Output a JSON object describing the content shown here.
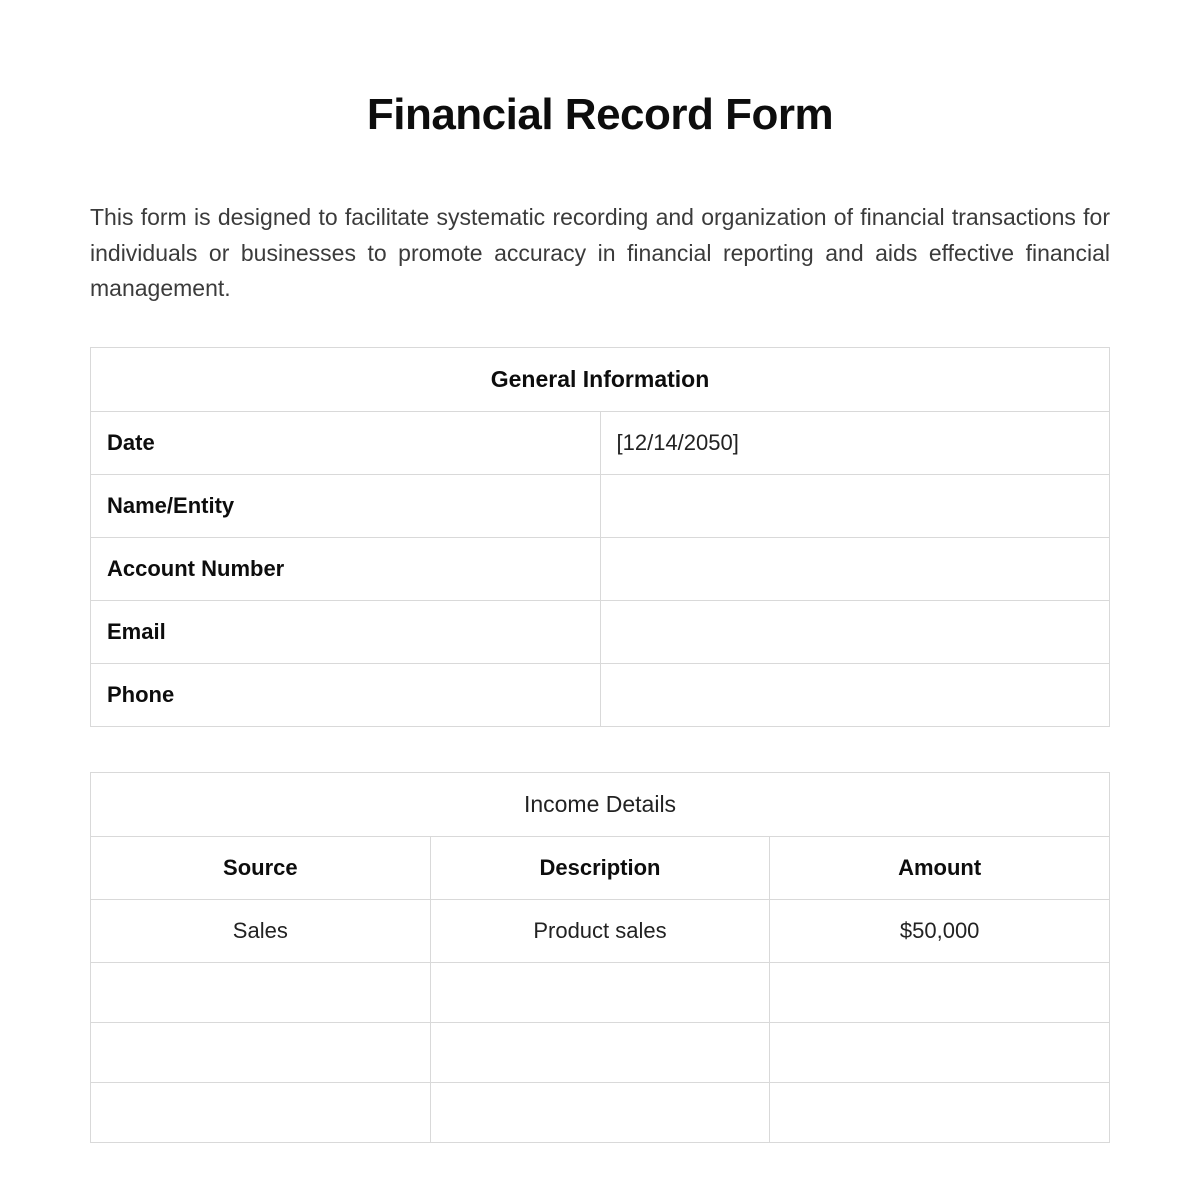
{
  "title": "Financial Record Form",
  "intro": "This form is designed to facilitate systematic recording and organization of financial transactions for individuals or businesses to promote accuracy in financial reporting and aids effective financial management.",
  "general_info": {
    "header": "General Information",
    "rows": [
      {
        "label": "Date",
        "value": "[12/14/2050]"
      },
      {
        "label": "Name/Entity",
        "value": ""
      },
      {
        "label": "Account Number",
        "value": ""
      },
      {
        "label": "Email",
        "value": ""
      },
      {
        "label": "Phone",
        "value": ""
      }
    ]
  },
  "income_details": {
    "header": "Income Details",
    "columns": [
      "Source",
      "Description",
      "Amount"
    ],
    "rows": [
      {
        "source": "Sales",
        "description": "Product sales",
        "amount": "$50,000"
      },
      {
        "source": "",
        "description": "",
        "amount": ""
      },
      {
        "source": "",
        "description": "",
        "amount": ""
      },
      {
        "source": "",
        "description": "",
        "amount": ""
      }
    ]
  }
}
